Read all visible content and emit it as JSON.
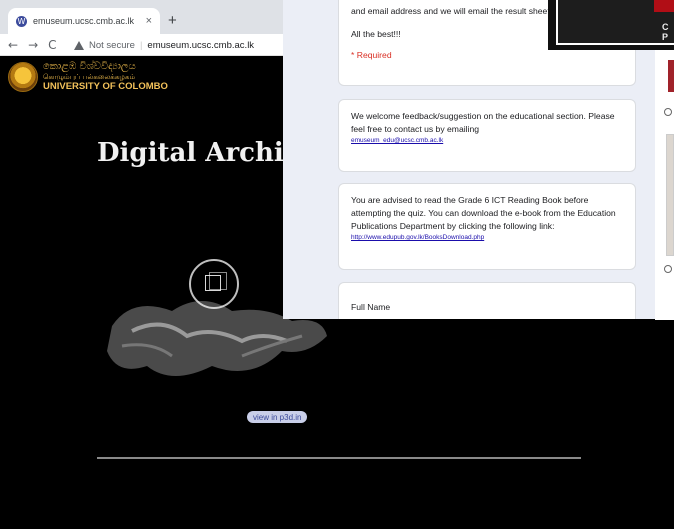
{
  "browser": {
    "tab_title": "emuseum.ucsc.cmb.ac.lk",
    "tab_close": "×",
    "new_tab": "+",
    "back": "←",
    "forward": "→",
    "reload": "C",
    "security": "Not secure",
    "url": "emuseum.ucsc.cmb.ac.lk"
  },
  "museum": {
    "logo_sinhala": "කොළඹ විශ්වවිද්‍යාලය",
    "logo_tamil": "கொழும்புப் பல்கலைக்கழகம்",
    "logo_english": "UNIVERSITY OF COLOMBO",
    "title": "Digital Archive",
    "viewin": "view in  p3d.in"
  },
  "form": {
    "intro_line": "and email address and we will email the result sheet.",
    "best": "All the best!!!",
    "required": "* Required",
    "feedback_text": "We welcome feedback/suggestion on the educational section. Please feel free to contact us by emailing",
    "feedback_email": "emuseum_edu@ucsc.cmb.ac.lk",
    "advice_text": "You are advised to read the Grade 6 ICT Reading Book before attempting the quiz. You can download the e-book from the Education Publications Department by clicking the following link:",
    "advice_link": "http://www.edupub.gov.lk/BooksDownload.php",
    "full_name_label": "Full Name"
  },
  "right_thumb": {
    "text": "C\nP"
  },
  "colors": {
    "logo_gold": "#f2c15a",
    "form_bg": "#ebeef6",
    "required_red": "#d93025"
  }
}
